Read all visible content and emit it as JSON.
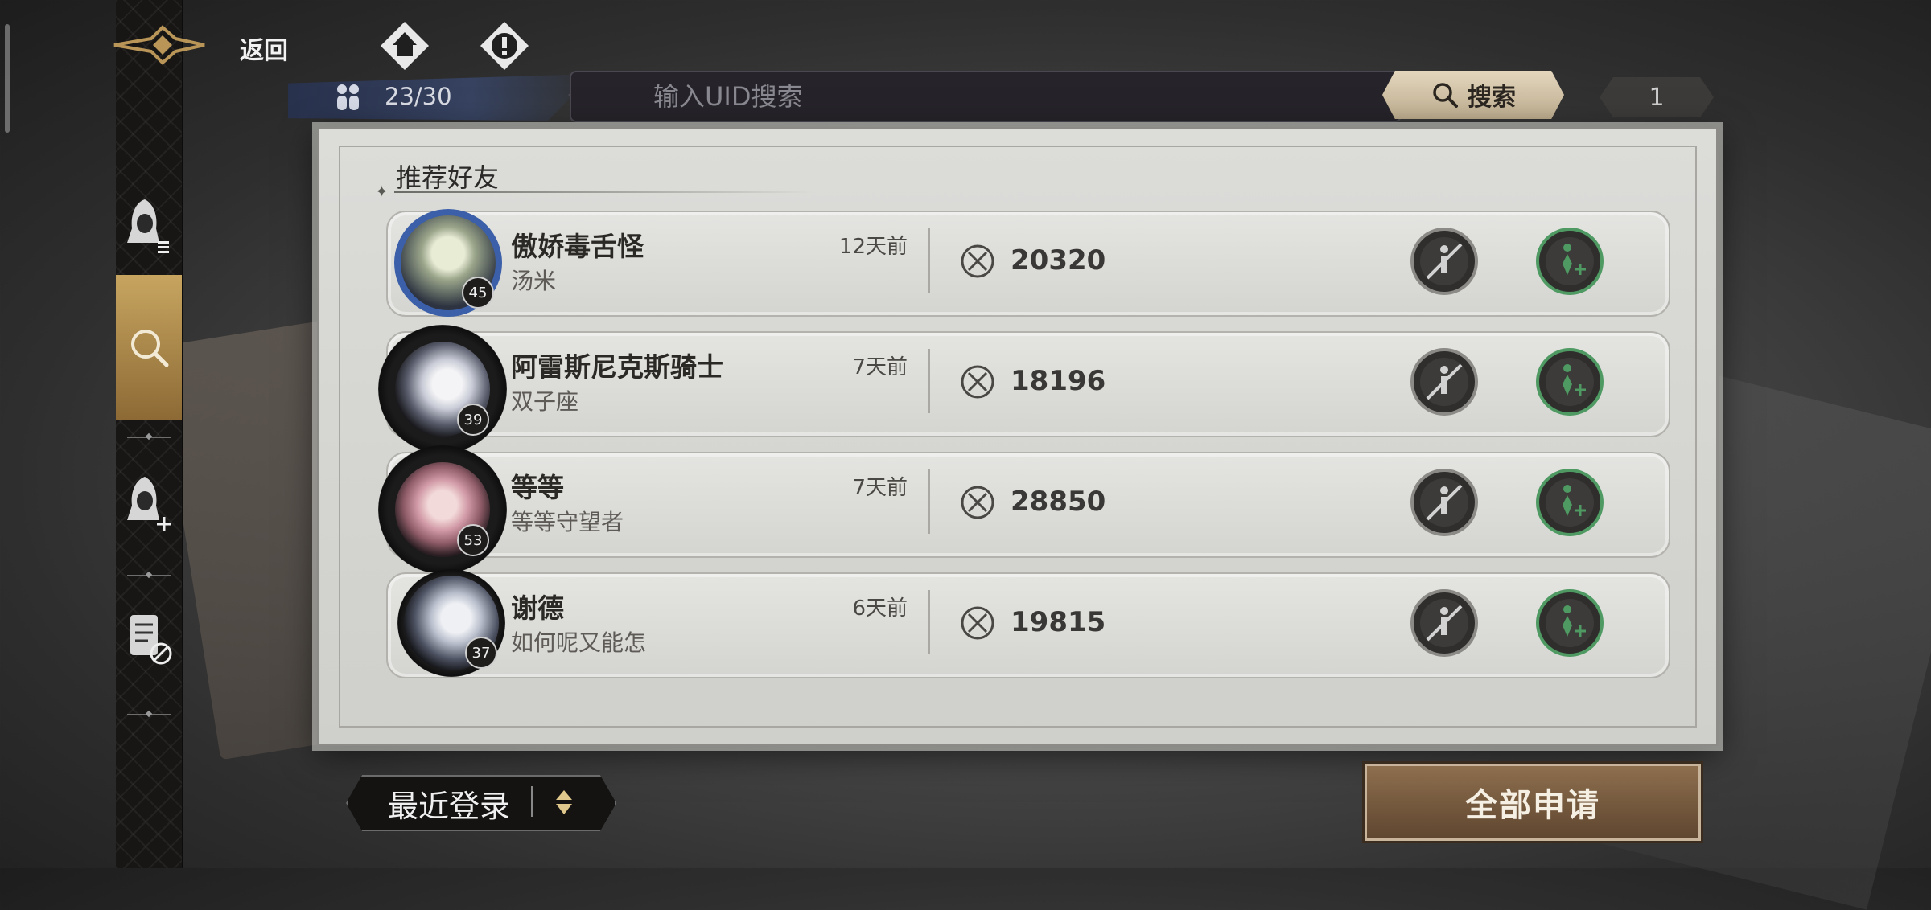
{
  "header": {
    "back_label": "返回",
    "friend_count": "23/30"
  },
  "search": {
    "placeholder": "输入UID搜索",
    "button_label": "搜索",
    "page": "1"
  },
  "sidebar": {
    "items": [
      {
        "icon": "friend-list-icon"
      },
      {
        "icon": "search-icon",
        "active": true
      },
      {
        "icon": "add-friend-icon"
      },
      {
        "icon": "blocklist-icon"
      }
    ]
  },
  "section": {
    "title": "推荐好友"
  },
  "friends": [
    {
      "name": "傲娇毒舌怪",
      "sub": "汤米",
      "time": "12天前",
      "level": "45",
      "power": "20320"
    },
    {
      "name": "阿雷斯尼克斯骑士",
      "sub": "双子座",
      "time": "7天前",
      "level": "39",
      "power": "18196"
    },
    {
      "name": "等等",
      "sub": "等等守望者",
      "time": "7天前",
      "level": "53",
      "power": "28850"
    },
    {
      "name": "谢德",
      "sub": "如何呢又能怎",
      "time": "6天前",
      "level": "37",
      "power": "19815"
    }
  ],
  "bottom": {
    "sort_label": "最近登录",
    "apply_all_label": "全部申请"
  },
  "colors": {
    "accent_gold": "#c7a560",
    "add_green": "#4f9a63",
    "panel": "#d8d8d5"
  }
}
